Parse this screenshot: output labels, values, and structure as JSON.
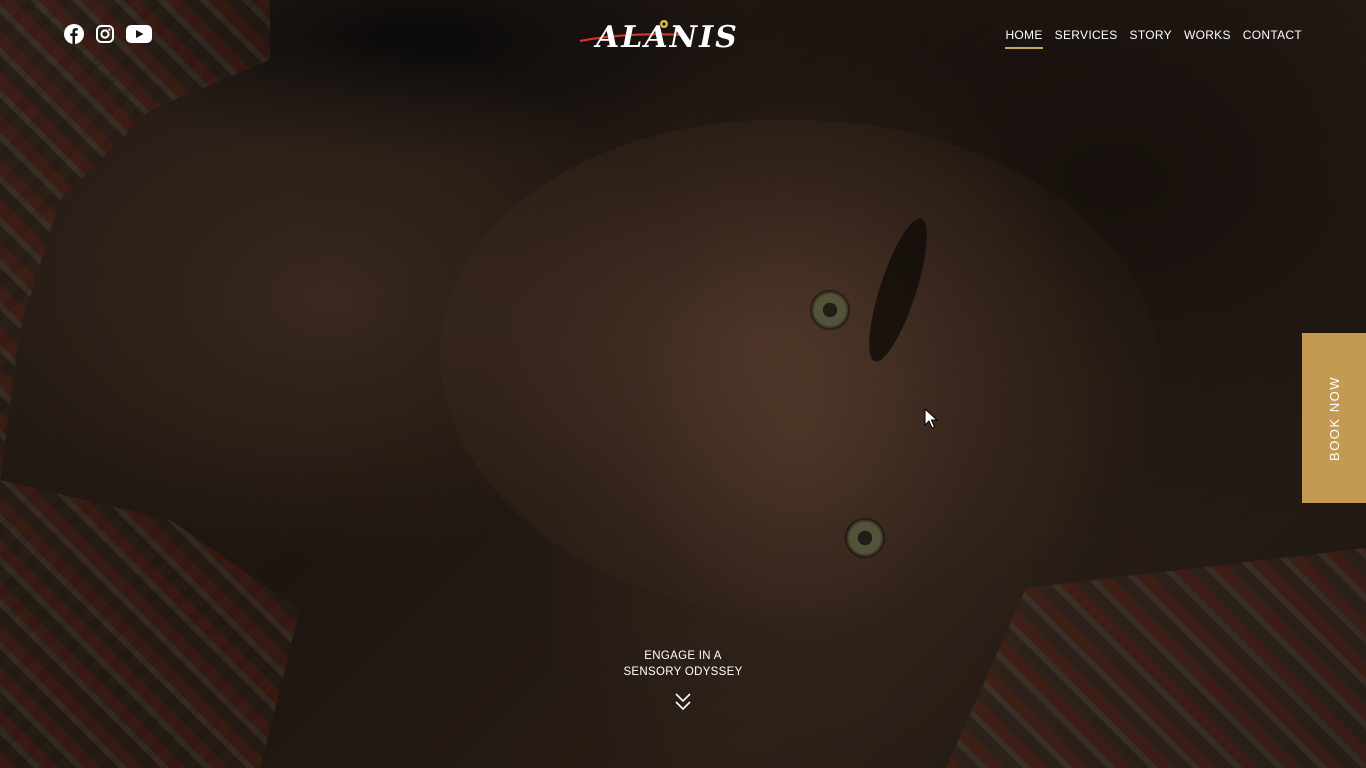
{
  "brand": {
    "logo_text": "ALANIS"
  },
  "social": [
    {
      "name": "facebook",
      "icon": "facebook-icon"
    },
    {
      "name": "instagram",
      "icon": "instagram-icon"
    },
    {
      "name": "youtube",
      "icon": "youtube-icon"
    }
  ],
  "nav": {
    "items": [
      {
        "label": "HOME",
        "active": true
      },
      {
        "label": "SERVICES",
        "active": false
      },
      {
        "label": "STORY",
        "active": false
      },
      {
        "label": "WORKS",
        "active": false
      },
      {
        "label": "CONTACT",
        "active": false
      }
    ]
  },
  "book_now": {
    "label": "BOOK NOW"
  },
  "hero": {
    "tagline_line1": "ENGAGE IN A",
    "tagline_line2": "SENSORY ODYSSEY",
    "scroll_icon": "double-chevron-down-icon"
  },
  "colors": {
    "accent": "#c49a52",
    "text": "#ffffff",
    "logo_red": "#d6342a"
  }
}
